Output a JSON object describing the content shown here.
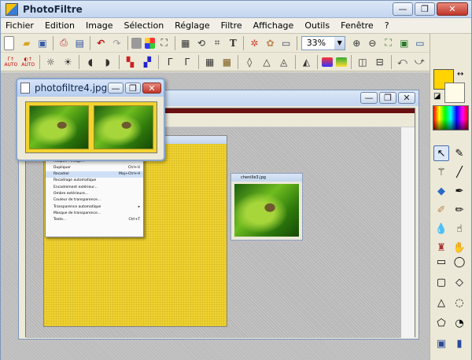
{
  "app": {
    "title": "PhotoFiltre"
  },
  "window_controls": {
    "minimize": "—",
    "maximize": "❐",
    "close": "✕"
  },
  "menu": [
    "Fichier",
    "Edition",
    "Image",
    "Sélection",
    "Réglage",
    "Filtre",
    "Affichage",
    "Outils",
    "Fenêtre",
    "?"
  ],
  "toolbar": {
    "zoom_value": "33%",
    "zoom_arrow": "▼"
  },
  "toolbar_icons_row1": [
    "new-file-icon",
    "open-file-icon",
    "save-icon",
    "print-icon",
    "scan-icon",
    "undo-icon",
    "redo-icon",
    "gray-square-icon",
    "color-grid-icon",
    "image-size-icon",
    "canvas-size-icon",
    "rotate-icon",
    "crop-icon",
    "text-icon",
    "filter-icon",
    "gallery-icon",
    "display-icon",
    "zoom-in-icon",
    "zoom-out-icon",
    "fit-icon",
    "actual-size-icon",
    "fullscreen-icon"
  ],
  "toolbar_icons_row2": [
    "auto-level-icon",
    "auto-contrast-icon",
    "brightness-down-icon",
    "brightness-up-icon",
    "contrast-down-icon",
    "contrast-up-icon",
    "saturation-down-icon",
    "saturation-up-icon",
    "gamma-down-icon",
    "gamma-up-icon",
    "grayscale-icon",
    "sepia-icon",
    "blur-icon",
    "sharpen-icon",
    "drop-icon",
    "fog-icon",
    "gradient-icon",
    "frame-icon",
    "mirror-icon",
    "flip-icon",
    "rotate-left-icon",
    "rotate-right-icon"
  ],
  "auto_labels": {
    "auto1": "AUTO",
    "auto2": "AUTO"
  },
  "color": {
    "foreground": "#ffd400",
    "background": "#fffbe9"
  },
  "navigator": {
    "title": "photofiltre4.jpg"
  },
  "inner_screenshot": {
    "small_image_title": "chenille3.jpg",
    "context_menu": [
      {
        "label": "Taille de l'image...",
        "shortcut": "Ctrl+H"
      },
      {
        "label": "Taille de la zone de travail...",
        "shortcut": "Maj+H"
      },
      {
        "label": "Adapter l'image...",
        "shortcut": ""
      },
      {
        "label": "Dupliquer",
        "shortcut": "Ctrl+U"
      },
      {
        "label": "Recadrer",
        "shortcut": "Maj+Ctrl+H"
      },
      {
        "label": "Recadrage automatique",
        "shortcut": ""
      },
      {
        "label": "Encadrement extérieur...",
        "shortcut": ""
      },
      {
        "label": "Ombre extérieure...",
        "shortcut": ""
      },
      {
        "label": "Couleur de transparence...",
        "shortcut": ""
      },
      {
        "label": "Transparence automatique",
        "shortcut": "▸"
      },
      {
        "label": "Masque de transparence...",
        "shortcut": ""
      },
      {
        "label": "Texte...",
        "shortcut": "Ctrl+T"
      }
    ]
  }
}
